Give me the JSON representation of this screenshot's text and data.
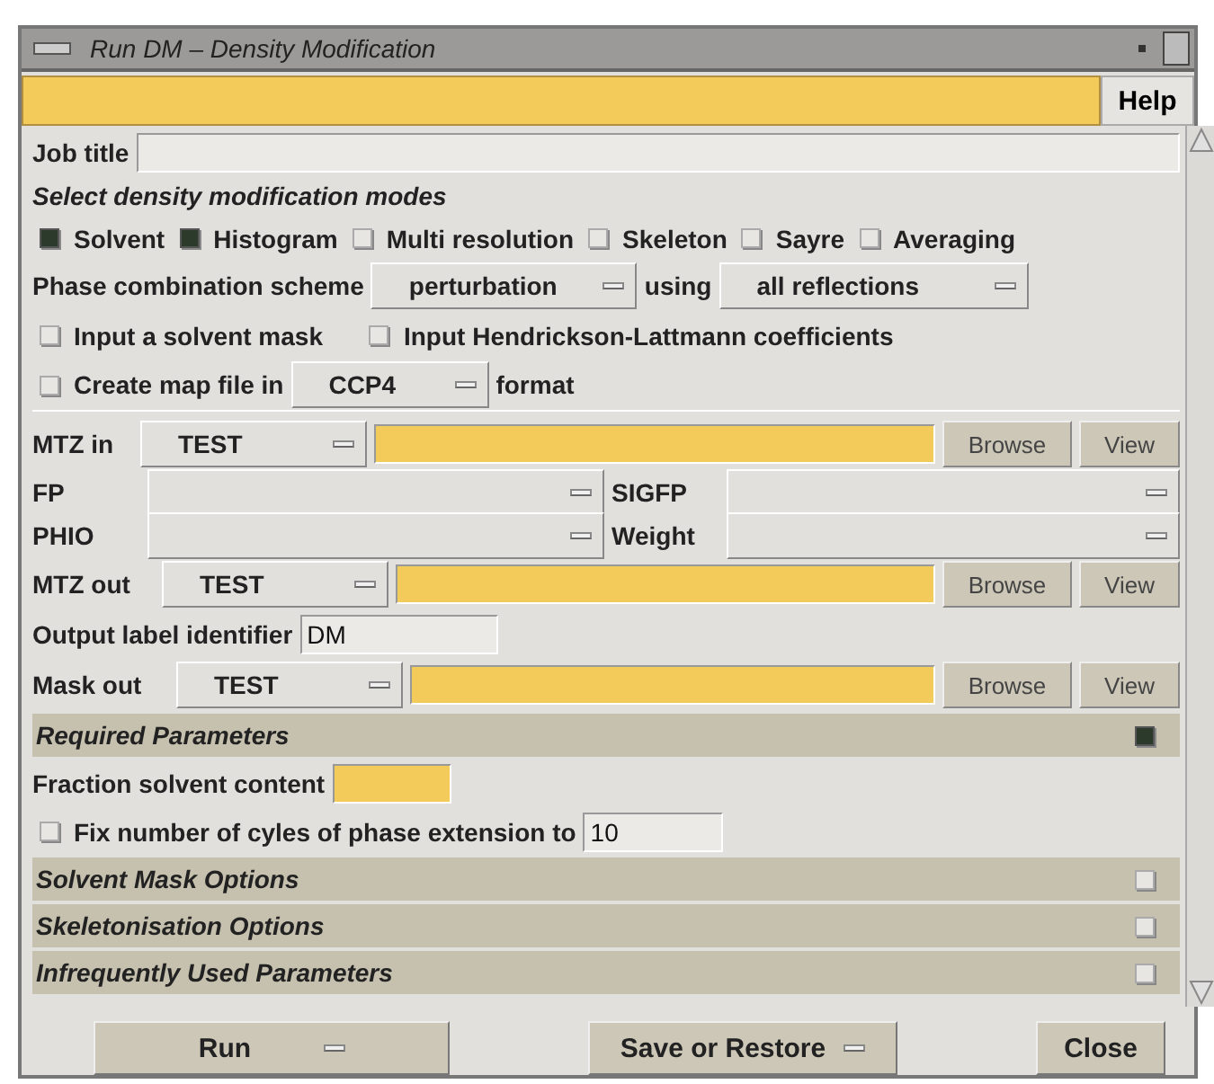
{
  "window": {
    "title": "Run DM – Density Modification"
  },
  "help_button": "Help",
  "job_title": {
    "label": "Job title"
  },
  "modes": {
    "heading": "Select density modification modes",
    "options": [
      {
        "label": "Solvent",
        "checked": true
      },
      {
        "label": "Histogram",
        "checked": true
      },
      {
        "label": "Multi resolution",
        "checked": false
      },
      {
        "label": "Skeleton",
        "checked": false
      },
      {
        "label": "Sayre",
        "checked": false
      },
      {
        "label": "Averaging",
        "checked": false
      }
    ]
  },
  "phase_combination": {
    "label": "Phase combination scheme",
    "scheme": "perturbation",
    "joiner": "using",
    "reflections": "all reflections"
  },
  "inputs": [
    {
      "label": "Input a solvent mask",
      "checked": false
    },
    {
      "label": "Input Hendrickson-Lattmann coefficients",
      "checked": false
    }
  ],
  "map_file": {
    "label": "Create map file in",
    "checked": false,
    "format": "CCP4",
    "suffix": "format"
  },
  "mtz_in": {
    "label": "MTZ in",
    "project": "TEST",
    "browse": "Browse",
    "view": "View"
  },
  "columns": [
    {
      "label": "FP",
      "label_2": "SIGFP"
    },
    {
      "label": "PHIO",
      "label_2": "Weight"
    }
  ],
  "mtz_out": {
    "label": "MTZ out",
    "project": "TEST",
    "browse": "Browse",
    "view": "View"
  },
  "output_label": {
    "label": "Output label identifier",
    "value": "DM"
  },
  "mask_out": {
    "label": "Mask out",
    "project": "TEST",
    "browse": "Browse",
    "view": "View"
  },
  "sections": [
    {
      "title": "Required Parameters",
      "expanded": true
    },
    {
      "title": "Solvent Mask Options",
      "expanded": false
    },
    {
      "title": "Skeletonisation Options",
      "expanded": false
    },
    {
      "title": "Infrequently Used Parameters",
      "expanded": false
    }
  ],
  "required": {
    "fraction_label": "Fraction solvent content",
    "fix_label": "Fix number of cyles of phase extension to",
    "fix_checked": false,
    "fix_value": "10"
  },
  "buttons": {
    "run": "Run",
    "save": "Save or Restore",
    "close": "Close"
  }
}
